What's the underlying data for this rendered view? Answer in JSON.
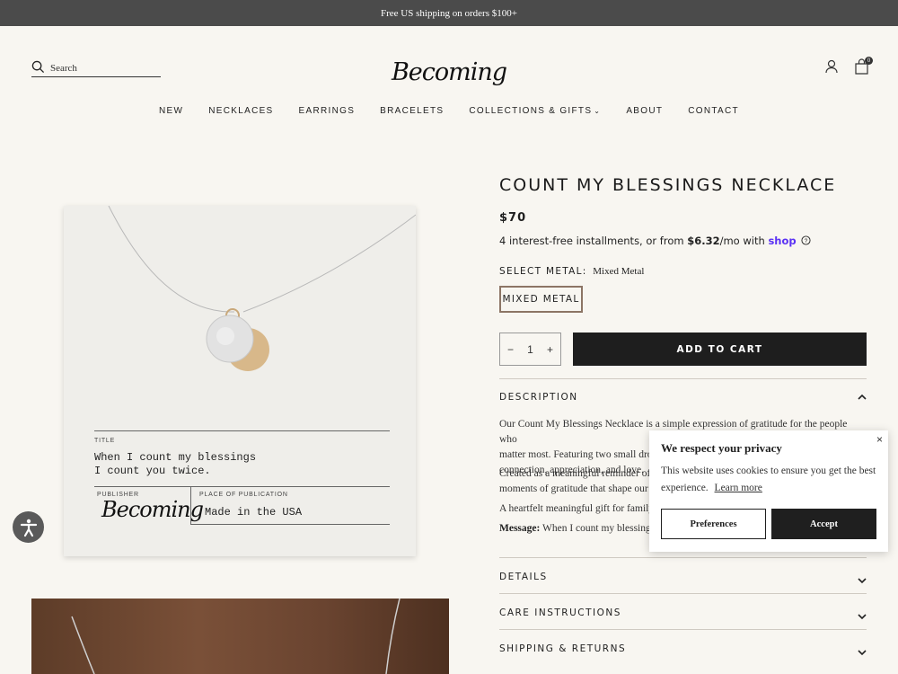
{
  "announcement": "Free US shipping on orders $100+",
  "header": {
    "search_placeholder": "Search",
    "logo": "Becoming",
    "cart_count": "0"
  },
  "nav": [
    "NEW",
    "NECKLACES",
    "EARRINGS",
    "BRACELETS",
    "COLLECTIONS & GIFTS",
    "ABOUT",
    "CONTACT"
  ],
  "product_card": {
    "title_label": "TITLE",
    "title_text_1": "When I count my blessings",
    "title_text_2": "I count you twice.",
    "publisher_label": "PUBLISHER",
    "publisher_sig": "Becoming",
    "place_label": "PLACE OF PUBLICATION",
    "place_value": "Made in the USA"
  },
  "product": {
    "title": "COUNT MY BLESSINGS NECKLACE",
    "price": "$70",
    "install_prefix": "4 interest-free installments, or from ",
    "install_amount": "$6.32",
    "install_suffix": "/mo with ",
    "install_brand": "shop",
    "metal_label": "SELECT METAL:",
    "metal_value": "Mixed Metal",
    "metal_option": "MIXED METAL",
    "qty_minus": "−",
    "qty_value": "1",
    "qty_plus": "+",
    "add_to_cart": "ADD TO CART"
  },
  "description": {
    "heading": "DESCRIPTION",
    "p1_l1": "Our Count My Blessings Necklace is a simple expression of gratitude for the people who",
    "p1_l2": "matter most. Featuring two small drop",
    "p1_l3": "connection, appreciation, and love.",
    "p2_l1": "Created as a meaningful reminder of t",
    "p2_l2": "moments of gratitude that shape our l",
    "p3": "A heartfelt meaningful gift for family",
    "msg_label": "Message:",
    "msg_text": "When I count my blessings"
  },
  "accordions": {
    "details": "DETAILS",
    "care": "CARE INSTRUCTIONS",
    "shipping": "SHIPPING & RETURNS"
  },
  "cookie": {
    "title": "We respect your privacy",
    "body_1": "This website uses cookies to ensure you get the best",
    "body_2": "experience.",
    "learn_more": "Learn more",
    "close": "×",
    "preferences": "Preferences",
    "accept": "Accept"
  }
}
